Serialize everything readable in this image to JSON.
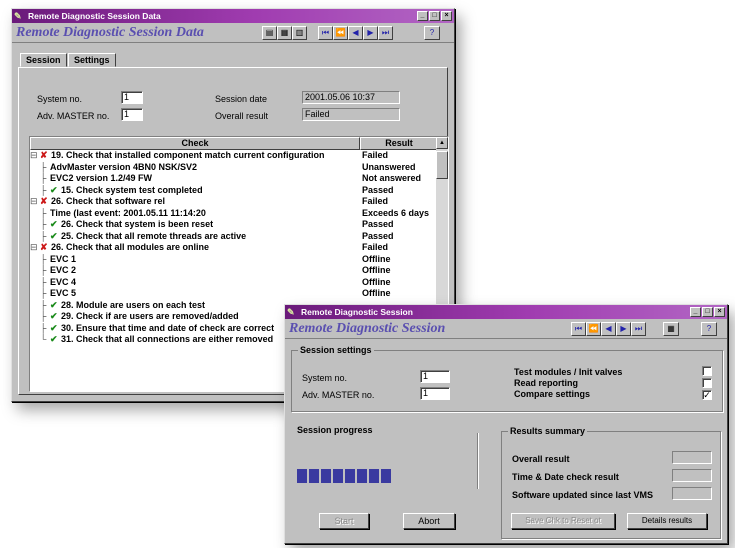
{
  "window1": {
    "title": "Remote Diagnostic Session Data",
    "app_title": "Remote Diagnostic Session Data",
    "tabs": [
      "Session",
      "Settings"
    ],
    "fields": {
      "system_no_label": "System no.",
      "system_no": "1",
      "adv_master_label": "Adv. MASTER no.",
      "adv_master": "1",
      "session_date_label": "Session date",
      "session_date": "2001.05.06 10:37",
      "overall_result_label": "Overall result",
      "overall_result": "Failed"
    },
    "table": {
      "headers": [
        "Check",
        "Result"
      ],
      "rows": [
        {
          "tree": "⊟",
          "status": "fail",
          "check": "19. Check that installed component match current configuration",
          "result": "Failed"
        },
        {
          "tree": "├",
          "status": "",
          "check": "AdvMaster version 4BN0 NSK/SV2",
          "result": "Unanswered"
        },
        {
          "tree": "├",
          "status": "",
          "check": "EVC2 version 1.2/49 FW",
          "result": "Not answered"
        },
        {
          "tree": "├",
          "status": "pass",
          "check": "15. Check system test completed",
          "result": "Passed"
        },
        {
          "tree": "⊟",
          "status": "fail",
          "check": "26. Check that software rel",
          "result": "Failed"
        },
        {
          "tree": "├",
          "status": "",
          "check": "Time (last event: 2001.05.11 11:14:20",
          "result": "Exceeds 6 days"
        },
        {
          "tree": "├",
          "status": "pass",
          "check": "26. Check that system is been reset",
          "result": "Passed"
        },
        {
          "tree": "├",
          "status": "pass",
          "check": "25. Check that all remote threads are active",
          "result": "Passed"
        },
        {
          "tree": "⊟",
          "status": "fail",
          "check": "26. Check that all modules are online",
          "result": "Failed"
        },
        {
          "tree": "├",
          "status": "",
          "check": "EVC 1",
          "result": "Offline"
        },
        {
          "tree": "├",
          "status": "",
          "check": "EVC 2",
          "result": "Offline"
        },
        {
          "tree": "├",
          "status": "",
          "check": "EVC 4",
          "result": "Offline"
        },
        {
          "tree": "├",
          "status": "",
          "check": "EVC 5",
          "result": "Offline"
        },
        {
          "tree": "├",
          "status": "pass",
          "check": "28. Module are users on each test",
          "result": ""
        },
        {
          "tree": "├",
          "status": "pass",
          "check": "29. Check if are users are removed/added",
          "result": ""
        },
        {
          "tree": "├",
          "status": "pass",
          "check": "30. Ensure that time and date of check are correct",
          "result": ""
        },
        {
          "tree": "└",
          "status": "pass",
          "check": "31. Check that all connections are either removed",
          "result": ""
        }
      ]
    }
  },
  "window2": {
    "title": "Remote Diagnostic Session",
    "app_title": "Remote Diagnostic Session",
    "session_settings_title": "Session settings",
    "system_no_label": "System no.",
    "system_no": "1",
    "adv_master_label": "Adv. MASTER no.",
    "adv_master": "1",
    "options": [
      {
        "label": "Test modules / Init valves",
        "checked": false
      },
      {
        "label": "Read reporting",
        "checked": false
      },
      {
        "label": "Compare settings",
        "checked": true
      }
    ],
    "session_progress_title": "Session progress",
    "progress_blocks": 8,
    "start_label": "Start",
    "abort_label": "Abort",
    "results_summary_title": "Results summary",
    "summary_items": [
      {
        "label": "Overall result",
        "value": ""
      },
      {
        "label": "Time & Date check result",
        "value": ""
      },
      {
        "label": "Software updated since last VMS",
        "value": ""
      }
    ],
    "save_button_label": "Save Chk to Reset ot",
    "details_button_label": "Details results"
  }
}
